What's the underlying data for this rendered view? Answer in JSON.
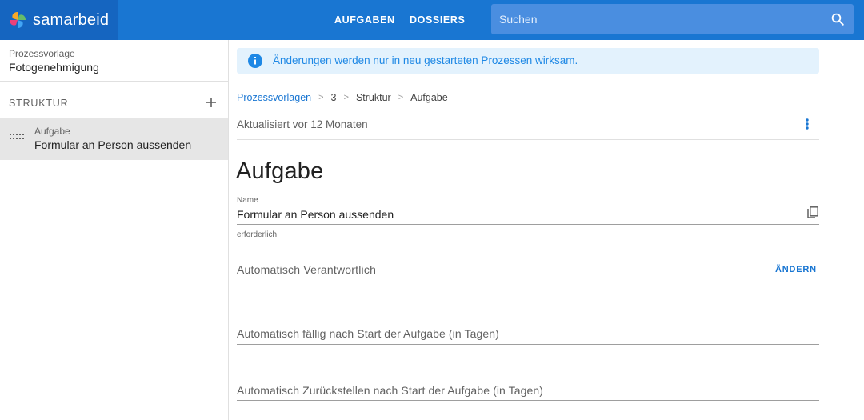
{
  "app": {
    "brand": "samarbeid"
  },
  "nav": {
    "tasks": "AUFGABEN",
    "dossiers": "DOSSIERS"
  },
  "search": {
    "placeholder": "Suchen",
    "value": ""
  },
  "sidebar": {
    "template_label": "Prozessvorlage",
    "template_name": "Fotogenehmigung",
    "structure_label": "STRUKTUR",
    "items": [
      {
        "type": "Aufgabe",
        "name": "Formular an Person aussenden"
      }
    ]
  },
  "banner": {
    "text": "Änderungen werden nur in neu gestarteten Prozessen wirksam."
  },
  "breadcrumb": [
    "Prozessvorlagen",
    "3",
    "Struktur",
    "Aufgabe"
  ],
  "breadcrumb_separator": ">",
  "updated": "Aktualisiert vor 12 Monaten",
  "page_title": "Aufgabe",
  "name_field": {
    "label": "Name",
    "value": "Formular an Person aussenden",
    "hint": "erforderlich"
  },
  "responsible": {
    "label": "Automatisch Verantwortlich",
    "action": "ÄNDERN"
  },
  "due_field": {
    "label": "Automatisch fällig nach Start der Aufgabe (in Tagen)"
  },
  "defer_field": {
    "label": "Automatisch Zurückstellen nach Start der Aufgabe (in Tagen)"
  },
  "colors": {
    "primary": "#1976d2",
    "brand_bg": "#1565c0",
    "banner_bg": "#e3f2fd",
    "selected_item": "#e6e6e6"
  },
  "icons": [
    "samarbeid-logo-icon",
    "search-icon",
    "add-icon",
    "drag-handle-icon",
    "info-icon",
    "more-vert-icon",
    "copy-icon"
  ]
}
